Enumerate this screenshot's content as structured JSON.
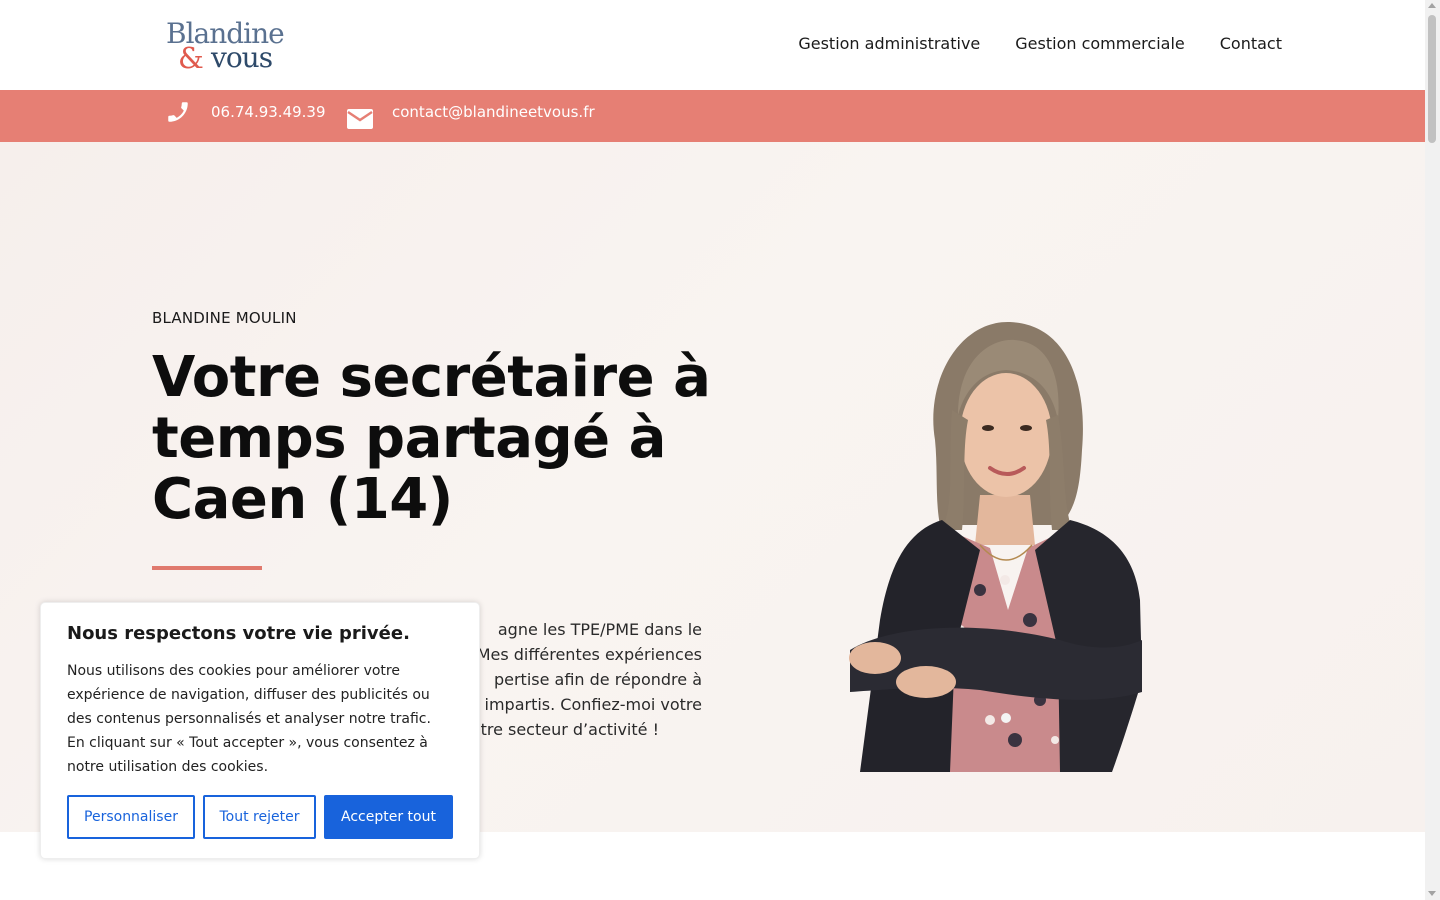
{
  "header": {
    "logo": {
      "line1": "Blandine",
      "ampersand": "&",
      "line2": "vous"
    },
    "nav": [
      "Gestion administrative",
      "Gestion commerciale",
      "Contact"
    ]
  },
  "contact_bar": {
    "phone": "06.74.93.49.39",
    "phone_icon": "phone-icon",
    "email": "contact@blandineetvous.fr",
    "email_icon": "envelope-icon",
    "color": "#e67f74"
  },
  "hero": {
    "subtitle": "BLANDINE MOULIN",
    "title": "Votre secrétaire à temps partagé à Caen (14)",
    "text": "agne les TPE/PME dans le . Mes différentes expériences pertise afin de répondre à s impartis. Confiez-moi votre votre secteur d’activité !",
    "text_lines": [
      "agne les TPE/PME dans le",
      ". Mes différentes expériences",
      "pertise afin de répondre à",
      "s impartis. Confiez-moi votre",
      "votre secteur d’activité !"
    ],
    "accent_color": "#e0796d"
  },
  "cookie": {
    "title": "Nous respectons votre vie privée.",
    "text": "Nous utilisons des cookies pour améliorer votre expérience de navigation, diffuser des publicités ou des contenus personnalisés et analyser notre trafic. En cliquant sur « Tout accepter », vous consentez à notre utilisation des cookies.",
    "buttons": {
      "customize": "Personnaliser",
      "reject": "Tout rejeter",
      "accept": "Accepter tout"
    },
    "button_color": "#1863dc"
  }
}
